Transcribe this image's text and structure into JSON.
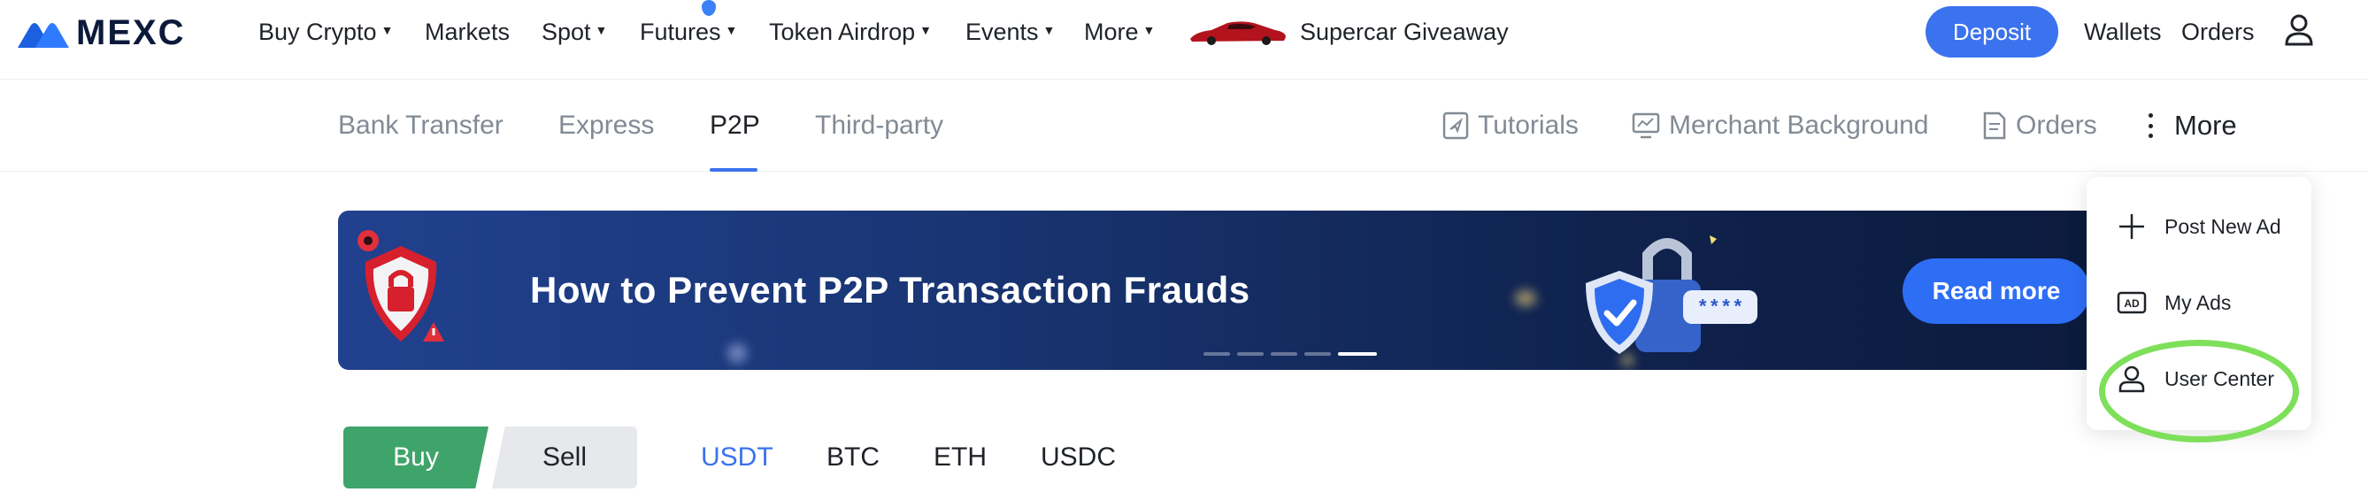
{
  "topnav": {
    "logo_text": "MEXC",
    "menu": [
      {
        "label": "Buy Crypto",
        "caret": true
      },
      {
        "label": "Markets",
        "caret": false
      },
      {
        "label": "Spot",
        "caret": true
      },
      {
        "label": "Futures",
        "caret": true
      },
      {
        "label": "Token Airdrop",
        "caret": true
      },
      {
        "label": "Events",
        "caret": true
      },
      {
        "label": "More",
        "caret": true
      }
    ],
    "promo": "Supercar Giveaway",
    "deposit": "Deposit",
    "wallets": "Wallets",
    "orders": "Orders"
  },
  "subnav": {
    "tabs": [
      "Bank Transfer",
      "Express",
      "P2P",
      "Third-party"
    ],
    "active_tab": "P2P",
    "tools": {
      "tutorials": "Tutorials",
      "merchant": "Merchant Background",
      "orders": "Orders",
      "more": "More"
    }
  },
  "banner": {
    "title": "How to Prevent P2P Transaction Frauds",
    "button": "Read more",
    "password_text": "****"
  },
  "trade": {
    "buy": "Buy",
    "sell": "Sell",
    "coins": [
      "USDT",
      "BTC",
      "ETH",
      "USDC"
    ],
    "active_coin": "USDT"
  },
  "dropdown": {
    "items": [
      "Post New Ad",
      "My Ads",
      "User Center"
    ],
    "ad_badge": "AD",
    "highlighted": "User Center"
  },
  "colors": {
    "accent": "#3b72ee",
    "buy": "#3fa46a",
    "highlight": "#7ee05a"
  }
}
